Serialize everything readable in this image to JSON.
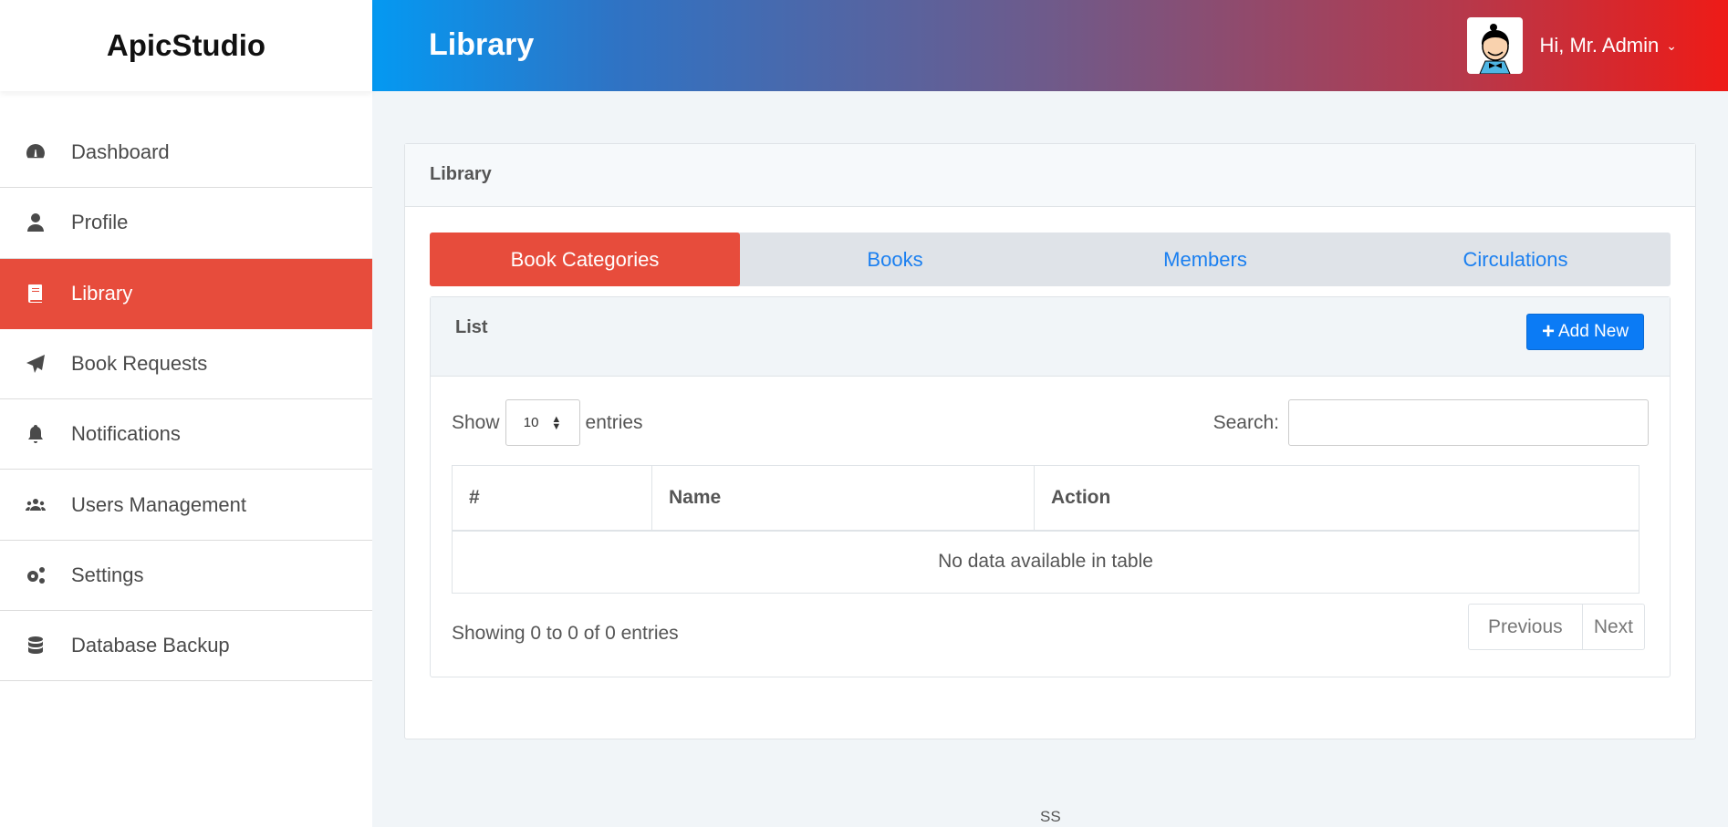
{
  "brand": "ApicStudio",
  "header": {
    "title": "Library",
    "user_greeting": "Hi, Mr. Admin"
  },
  "sidebar": {
    "items": [
      {
        "label": "Dashboard",
        "icon": "dashboard-icon"
      },
      {
        "label": "Profile",
        "icon": "user-icon"
      },
      {
        "label": "Library",
        "icon": "book-icon",
        "active": true
      },
      {
        "label": "Book Requests",
        "icon": "paper-plane-icon"
      },
      {
        "label": "Notifications",
        "icon": "bell-icon"
      },
      {
        "label": "Users Management",
        "icon": "users-icon"
      },
      {
        "label": "Settings",
        "icon": "cogs-icon"
      },
      {
        "label": "Database Backup",
        "icon": "database-icon"
      }
    ]
  },
  "card": {
    "title": "Library"
  },
  "tabs": [
    {
      "label": "Book Categories",
      "active": true
    },
    {
      "label": "Books"
    },
    {
      "label": "Members"
    },
    {
      "label": "Circulations"
    }
  ],
  "panel": {
    "title": "List",
    "add_label": "Add New"
  },
  "table_controls": {
    "show_label": "Show",
    "entries_value": "10",
    "entries_label": "entries",
    "search_label": "Search:",
    "search_value": ""
  },
  "table": {
    "columns": [
      "#",
      "Name",
      "Action"
    ],
    "empty": "No data available in table"
  },
  "info": "Showing 0 to 0 of 0 entries",
  "pagination": {
    "previous": "Previous",
    "next": "Next"
  },
  "footer": "SS",
  "colors": {
    "accent": "#e74c3c",
    "primary": "#0b7bf5",
    "header_start": "#0499f2",
    "header_end": "#ee1b17"
  }
}
